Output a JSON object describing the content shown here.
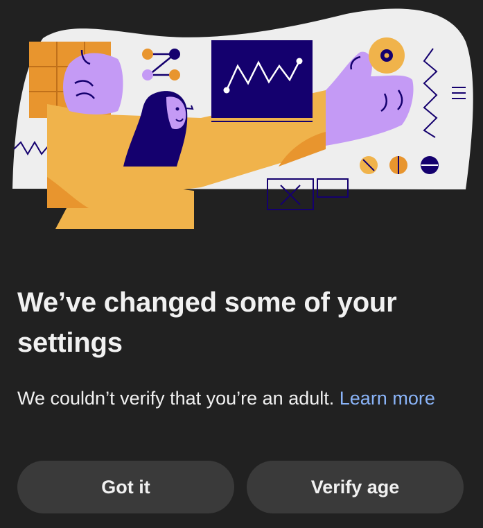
{
  "dialog": {
    "title": "We’ve changed some of your settings",
    "message": "We couldn’t verify that you’re an adult.",
    "learn_more": "Learn more"
  },
  "buttons": {
    "got_it": "Got it",
    "verify_age": "Verify age"
  },
  "colors": {
    "background": "#212121",
    "button": "#3a3a3a",
    "link": "#8ab4f8",
    "illustration_bg": "#eeeeee",
    "navy": "#14006e",
    "yellow": "#f0b34b",
    "orange": "#e8952e",
    "lavender": "#c49af5"
  },
  "illustration": {
    "name": "person-at-screen-illustration"
  }
}
